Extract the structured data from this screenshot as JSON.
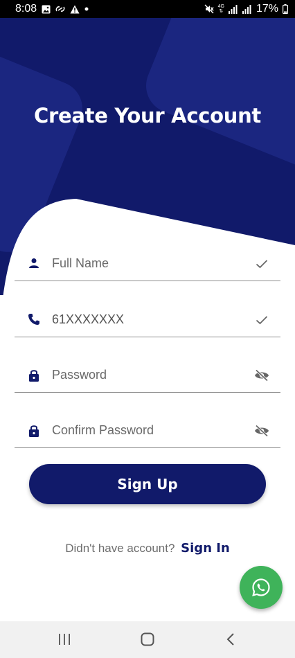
{
  "status_bar": {
    "time": "8:08",
    "battery": "17%",
    "network": "4G",
    "left_icons": [
      "gallery-icon",
      "link-icon",
      "warning-icon",
      "dot-icon"
    ],
    "right_icons": [
      "mute-icon",
      "network-4g-icon",
      "signal-icon",
      "signal-icon",
      "battery-icon"
    ]
  },
  "header": {
    "title": "Create Your Account"
  },
  "form": {
    "fields": [
      {
        "name": "full-name",
        "placeholder": "Full Name",
        "value": "",
        "icon": "person-icon",
        "trailing_icon": "check-icon"
      },
      {
        "name": "phone",
        "placeholder": "",
        "value": "61XXXXXXX",
        "icon": "phone-icon",
        "trailing_icon": "check-icon"
      },
      {
        "name": "password",
        "placeholder": "Password",
        "value": "",
        "icon": "lock-icon",
        "trailing_icon": "eye-off-icon"
      },
      {
        "name": "confirm-password",
        "placeholder": "Confirm Password",
        "value": "",
        "icon": "lock-icon",
        "trailing_icon": "eye-off-icon"
      }
    ],
    "submit_label": "Sign Up"
  },
  "footer": {
    "prompt": "Didn't have account?",
    "link": "Sign In"
  },
  "fab_icon": "whatsapp-icon",
  "nav": {
    "buttons": [
      "recent-apps-icon",
      "home-icon",
      "back-icon"
    ]
  },
  "colors": {
    "primary": "#111a6a",
    "hero_shape": "#1b2680",
    "fab": "#3fb35a",
    "divider": "#8e8e8e"
  }
}
